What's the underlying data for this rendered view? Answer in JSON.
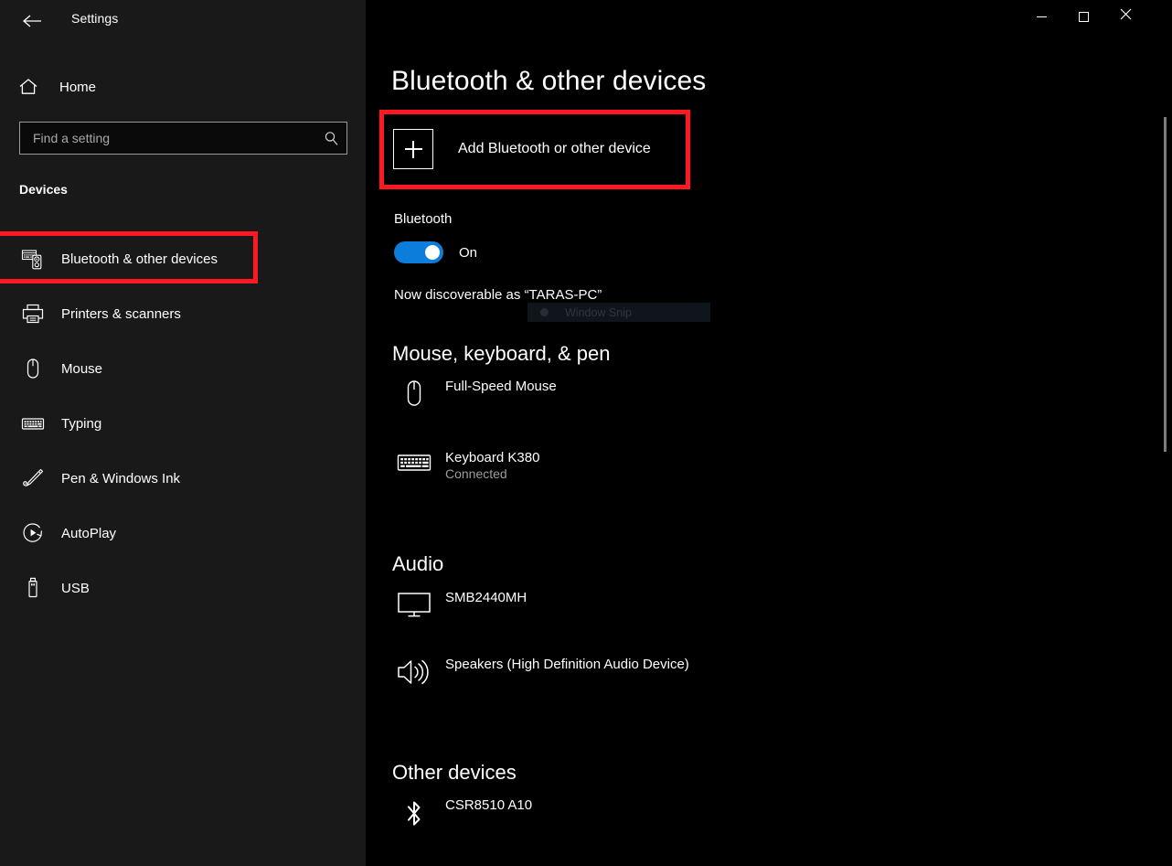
{
  "window": {
    "title": "Settings",
    "back_icon": "back-arrow-icon",
    "controls": {
      "minimize": "minimize-icon",
      "maximize": "maximize-icon",
      "close": "close-icon"
    }
  },
  "sidebar": {
    "home": {
      "label": "Home",
      "icon": "home-icon"
    },
    "search": {
      "value": "",
      "placeholder": "Find a setting",
      "icon": "search-icon"
    },
    "category": "Devices",
    "items": [
      {
        "label": "Bluetooth & other devices",
        "icon": "bluetooth-devices-icon",
        "selected": true
      },
      {
        "label": "Printers & scanners",
        "icon": "printer-icon",
        "selected": false
      },
      {
        "label": "Mouse",
        "icon": "mouse-icon",
        "selected": false
      },
      {
        "label": "Typing",
        "icon": "keyboard-icon",
        "selected": false
      },
      {
        "label": "Pen & Windows Ink",
        "icon": "pen-icon",
        "selected": false
      },
      {
        "label": "AutoPlay",
        "icon": "autoplay-icon",
        "selected": false
      },
      {
        "label": "USB",
        "icon": "usb-icon",
        "selected": false
      }
    ]
  },
  "main": {
    "page_title": "Bluetooth & other devices",
    "add_device": {
      "label": "Add Bluetooth or other device",
      "icon": "plus-icon"
    },
    "bluetooth": {
      "label": "Bluetooth",
      "toggle_state": "On",
      "toggle_on": true,
      "accent_color": "#0d7ddb",
      "discoverable_text": "Now discoverable as “TARAS-PC”"
    },
    "overlay": {
      "label": "Window Snip",
      "icon": "bullet-dot-icon"
    },
    "groups": [
      {
        "title": "Mouse, keyboard, & pen",
        "devices": [
          {
            "name": "Full-Speed Mouse",
            "status": "",
            "icon": "mouse-icon"
          },
          {
            "name": "Keyboard K380",
            "status": "Connected",
            "icon": "keyboard-icon"
          }
        ]
      },
      {
        "title": "Audio",
        "devices": [
          {
            "name": "SMB2440MH",
            "status": "",
            "icon": "monitor-icon"
          },
          {
            "name": "Speakers (High Definition Audio Device)",
            "status": "",
            "icon": "speaker-icon"
          }
        ]
      },
      {
        "title": "Other devices",
        "devices": [
          {
            "name": "CSR8510 A10",
            "status": "",
            "icon": "bluetooth-icon"
          }
        ]
      }
    ]
  },
  "annotations": {
    "color": "#ff1822",
    "boxes": [
      {
        "target": "add-bluetooth-or-other-device-button"
      },
      {
        "target": "sidebar-item-bluetooth-other-devices"
      }
    ]
  },
  "scrollbar": {
    "orientation": "vertical",
    "thumb_position": "top"
  }
}
